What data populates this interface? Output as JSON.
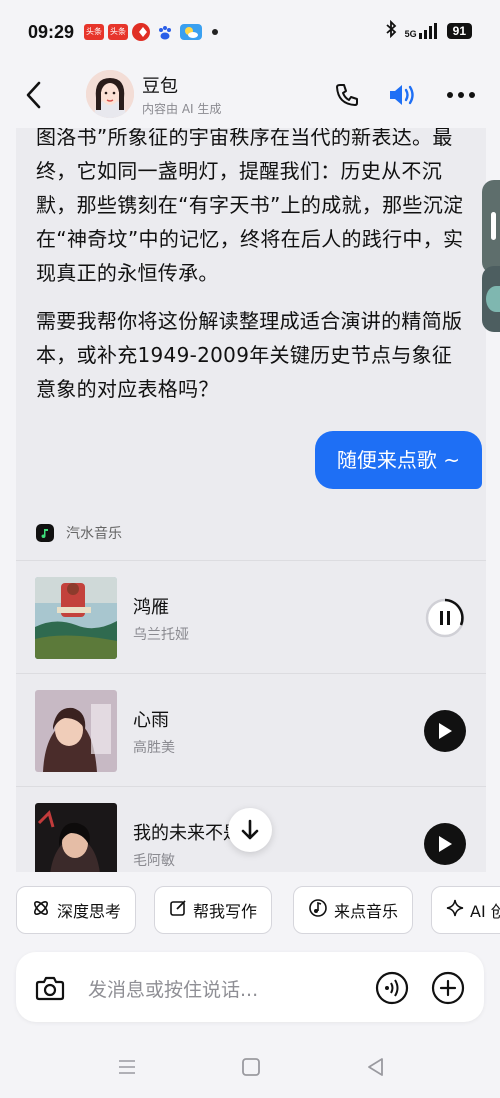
{
  "status_bar": {
    "time": "09:29",
    "apps": [
      {
        "name": "toutiao-icon",
        "label": "头条",
        "color": "#e7352b"
      },
      {
        "name": "toutiao-icon",
        "label": "头条",
        "color": "#e7352b"
      },
      {
        "name": "pinduoduo-icon",
        "label": "",
        "color": "#e02e24"
      },
      {
        "name": "baidu-paw-icon",
        "label": "",
        "color": "#2a5ee8"
      },
      {
        "name": "weather-icon",
        "label": "",
        "color": "#3aa0f0"
      }
    ],
    "network": "5G",
    "battery": "91"
  },
  "header": {
    "title": "豆包",
    "subtitle": "内容由 AI 生成",
    "accent": "#1e6ff5"
  },
  "chat": {
    "ai_message_paragraphs": [
      "图洛书”所象征的宇宙秩序在当代的新表达。最终，它如同一盏明灯，提醒我们：历史从不沉默，那些镌刻在“有字天书”上的成就，那些沉淀在“神奇坟”中的记忆，终将在后人的践行中，实现真正的永恒传承。",
      "需要我帮你将这份解读整理成适合演讲的精简版本，或补充1949-2009年关键历史节点与象征意象的对应表格吗？"
    ],
    "user_message": "随便来点歌 ~",
    "music_card": {
      "source": "汽水音乐",
      "songs": [
        {
          "title": "鸿雁",
          "artist": "乌兰托娅",
          "state": "playing"
        },
        {
          "title": "心雨",
          "artist": "高胜美",
          "state": "paused"
        },
        {
          "title": "我的未来不是梦",
          "artist": "毛阿敏",
          "state": "paused"
        }
      ]
    }
  },
  "quick_actions": [
    {
      "label": "深度思考",
      "icon": "deep-think-icon"
    },
    {
      "label": "帮我写作",
      "icon": "pen-icon"
    },
    {
      "label": "来点音乐",
      "icon": "music-icon"
    },
    {
      "label": "AI 创作",
      "icon": "sparkle-icon"
    }
  ],
  "input": {
    "placeholder": "发消息或按住说话..."
  }
}
